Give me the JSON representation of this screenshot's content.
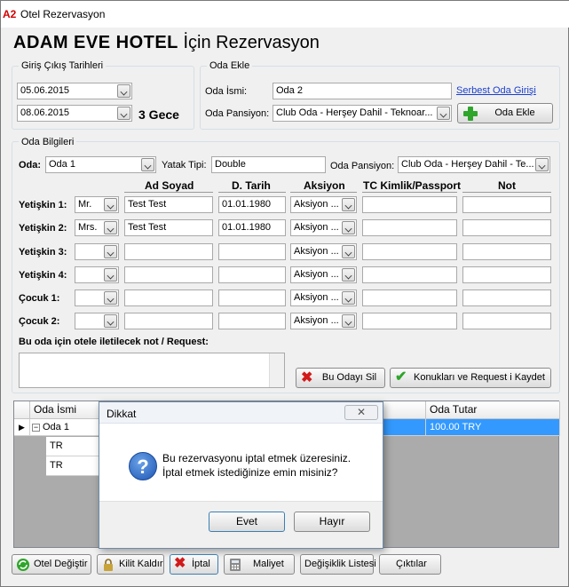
{
  "window": {
    "title": "Otel Rezervasyon",
    "logo": "A2"
  },
  "header": {
    "hotel_name": "ADAM  EVE HOTEL",
    "suffix": "İçin Rezervasyon"
  },
  "dates": {
    "group_label": "Giriş Çıkış Tarihleri",
    "checkin": "05.06.2015",
    "checkout": "08.06.2015",
    "nights": "3 Gece"
  },
  "add_room": {
    "group_label": "Oda Ekle",
    "name_label": "Oda İsmi:",
    "name_value": "Oda 2",
    "free_room_link": "Serbest Oda Girişi",
    "board_label": "Oda Pansiyon:",
    "board_value": "Club Oda - Herşey Dahil - Teknoar...",
    "add_button": "Oda Ekle"
  },
  "room_info": {
    "group_label": "Oda Bilgileri",
    "room_label": "Oda:",
    "room_value": "Oda 1",
    "bed_label": "Yatak Tipi:",
    "bed_value": "Double",
    "board_label": "Oda Pansiyon:",
    "board_value": "Club Oda - Herşey Dahil - Te...",
    "columns": [
      "Ad Soyad",
      "D. Tarih",
      "Aksiyon",
      "TC Kimlik/Passport",
      "Not"
    ],
    "guests": [
      {
        "label": "Yetişkin 1:",
        "title": "Mr.",
        "name": "Test Test",
        "dob": "01.01.1980",
        "action": "Aksiyon ...",
        "tc": "",
        "note": ""
      },
      {
        "label": "Yetişkin 2:",
        "title": "Mrs.",
        "name": "Test Test",
        "dob": "01.01.1980",
        "action": "Aksiyon ...",
        "tc": "",
        "note": ""
      },
      {
        "label": "Yetişkin 3:",
        "title": "",
        "name": "",
        "dob": "",
        "action": "Aksiyon ...",
        "tc": "",
        "note": ""
      },
      {
        "label": "Yetişkin 4:",
        "title": "",
        "name": "",
        "dob": "",
        "action": "Aksiyon ...",
        "tc": "",
        "note": ""
      },
      {
        "label": "Çocuk 1:",
        "title": "",
        "name": "",
        "dob": "",
        "action": "Aksiyon ...",
        "tc": "",
        "note": ""
      },
      {
        "label": "Çocuk 2:",
        "title": "",
        "name": "",
        "dob": "",
        "action": "Aksiyon ...",
        "tc": "",
        "note": ""
      }
    ],
    "note_label": "Bu oda için otele iletilecek not / Request:",
    "delete_button": "Bu Odayı Sil",
    "save_button": "Konukları ve Request i Kaydet"
  },
  "grid": {
    "col_room": "Oda İsmi",
    "col_total": "Oda Tutar",
    "rows": [
      {
        "name": "Oda 1",
        "total": "100.00 TRY"
      }
    ],
    "sub_rows": [
      "TR",
      "TR"
    ]
  },
  "dialog": {
    "title": "Dikkat",
    "line1": "Bu rezervasyonu iptal etmek üzeresiniz.",
    "line2": "İptal etmek istediğinize emin misiniz?",
    "yes": "Evet",
    "no": "Hayır"
  },
  "toolbar": {
    "change_hotel": "Otel Değiştir",
    "remove_lock": "Kilit Kaldır",
    "cancel": "İptal",
    "cost": "Maliyet",
    "changes": "Değişiklik Listesi",
    "exit": "Çıktılar"
  }
}
